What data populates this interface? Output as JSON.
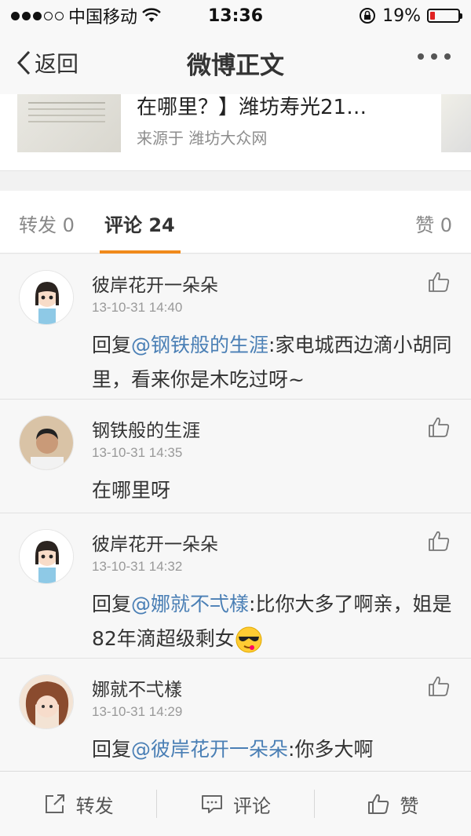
{
  "status": {
    "carrier": "中国移动",
    "time": "13:36",
    "battery": "19%",
    "battery_level": 0.19,
    "signal_dots_filled": 3,
    "signal_dots_total": 5
  },
  "nav": {
    "back_label": "返回",
    "title": "微博正文"
  },
  "article_card": {
    "title": "在哪里？】潍坊寿光21…",
    "source": "来源于  潍坊大众网"
  },
  "tabs": {
    "repost": "转发 0",
    "comment": "评论 24",
    "like": "赞 0"
  },
  "comments": [
    {
      "user": "彼岸花开一朵朵",
      "time": "13-10-31 14:40",
      "prefix": "回复",
      "mention": "@钢铁般的生涯",
      "text": ":家电城西边滴小胡同里，看来你是木吃过呀~"
    },
    {
      "user": "钢铁般的生涯",
      "time": "13-10-31 14:35",
      "prefix": "",
      "mention": "",
      "text": "在哪里呀"
    },
    {
      "user": "彼岸花开一朵朵",
      "time": "13-10-31 14:32",
      "prefix": "回复",
      "mention": "@娜就不弌樣",
      "text": ":比你大多了啊亲，姐是82年滴超级剩女"
    },
    {
      "user": "娜就不弌樣",
      "time": "13-10-31 14:29",
      "prefix": "回复",
      "mention": "@彼岸花开一朵朵",
      "text": ":你多大啊"
    }
  ],
  "toolbar": {
    "repost_label": "转发",
    "comment_label": "评论",
    "like_label": "赞"
  },
  "colors": {
    "accent": "#f08a1c",
    "mention": "#4a7fb5",
    "battery_low": "#e02020"
  }
}
